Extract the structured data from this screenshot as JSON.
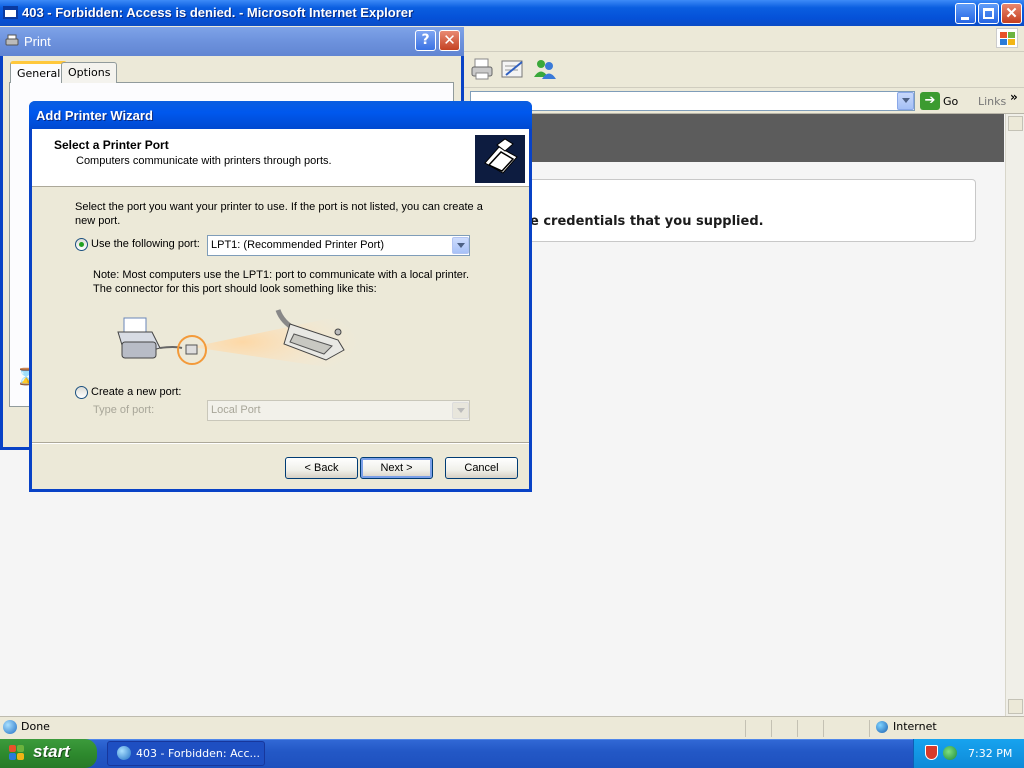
{
  "ie": {
    "title": "403 - Forbidden: Access is denied. - Microsoft Internet Explorer",
    "address": {
      "go_label": "Go",
      "links_label": "Links",
      "chevron": "»"
    },
    "content": {
      "error_fragment": "e credentials that you supplied."
    },
    "status": {
      "text": "Done",
      "zone": "Internet"
    }
  },
  "print_dialog": {
    "title": "Print",
    "help_glyph": "?",
    "close_glyph": "✕",
    "tabs": [
      {
        "label": "General"
      },
      {
        "label": "Options"
      }
    ]
  },
  "wizard": {
    "title": "Add Printer Wizard",
    "header_title": "Select a Printer Port",
    "header_subtitle": "Computers communicate with printers through ports.",
    "intro": "Select the port you want your printer to use.  If the port is not listed, you can create a new port.",
    "use_existing_label": "Use the following port:",
    "port_value": "LPT1: (Recommended Printer Port)",
    "note": "Note: Most computers use the LPT1: port to communicate with a local printer. The connector for this port should look something like this:",
    "create_new_label": "Create a new port:",
    "type_label": "Type of port:",
    "type_value": "Local Port",
    "buttons": {
      "back": "< Back",
      "next": "Next >",
      "cancel": "Cancel"
    }
  },
  "taskbar": {
    "start_label": "start",
    "task_label": "403 - Forbidden: Acc...",
    "clock": "7:32 PM"
  },
  "colors": {
    "xp_blue": "#0842c6",
    "start_green": "#2e8a2e",
    "tray_blue": "#0e8ad8",
    "radio_dot": "#21a121"
  }
}
